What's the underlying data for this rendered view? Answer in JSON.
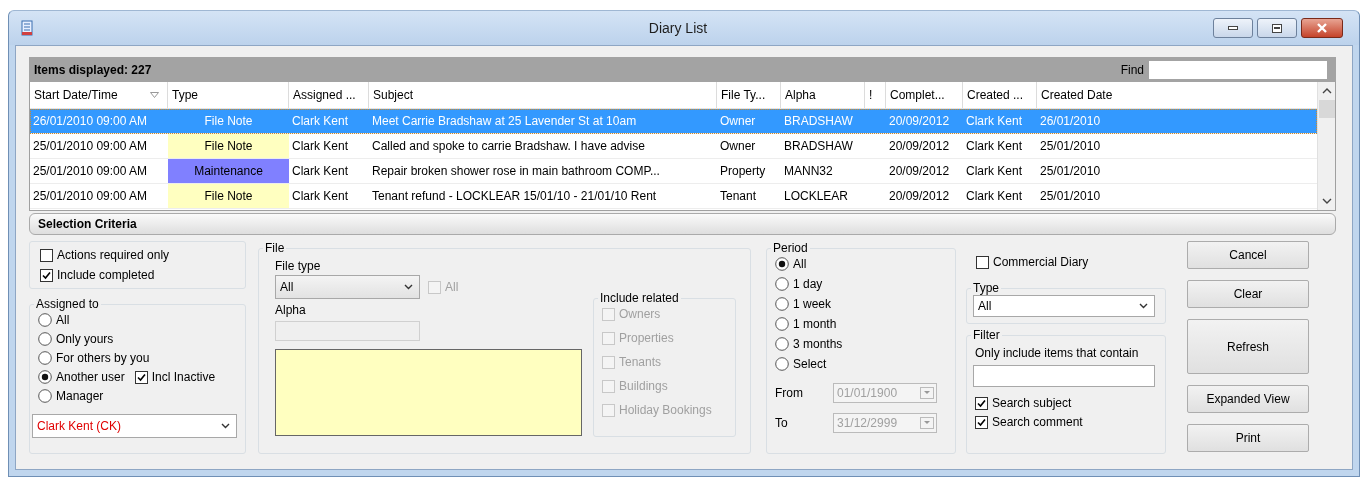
{
  "window": {
    "title": "Diary List"
  },
  "list": {
    "items_displayed": "Items displayed: 227",
    "find_label": "Find",
    "columns": [
      {
        "label": "Start Date/Time",
        "sorted": true
      },
      {
        "label": "Type",
        "sorted": false
      },
      {
        "label": "Assigned ...",
        "sorted": false
      },
      {
        "label": "Subject",
        "sorted": false
      },
      {
        "label": "File Ty...",
        "sorted": false
      },
      {
        "label": "Alpha",
        "sorted": false
      },
      {
        "label": "!",
        "sorted": false
      },
      {
        "label": "Complet...",
        "sorted": false
      },
      {
        "label": "Created ...",
        "sorted": false
      },
      {
        "label": "Created Date",
        "sorted": false
      }
    ],
    "rows": [
      {
        "selected": true,
        "cells": [
          "26/01/2010 09:00 AM",
          "File Note",
          "Clark Kent",
          "Meet Carrie Bradshaw at 25 Lavender St at 10am",
          "Owner",
          "BRADSHAW",
          "",
          "20/09/2012",
          "Clark Kent",
          "26/01/2010"
        ]
      },
      {
        "selected": false,
        "color": "#ffffc0",
        "cells": [
          "25/01/2010 09:00 AM",
          "File Note",
          "Clark Kent",
          "Called and spoke to carrie Bradshaw. I have advise",
          "Owner",
          "BRADSHAW",
          "",
          "20/09/2012",
          "Clark Kent",
          "25/01/2010"
        ]
      },
      {
        "selected": false,
        "color": "#8080ff",
        "cells": [
          "25/01/2010 09:00 AM",
          "Maintenance",
          "Clark Kent",
          "Repair broken shower rose in main bathroom COMP...",
          "Property",
          "MANN32",
          "",
          "20/09/2012",
          "Clark Kent",
          "25/01/2010"
        ]
      },
      {
        "selected": false,
        "color": "#ffffc0",
        "cells": [
          "25/01/2010 09:00 AM",
          "File Note",
          "Clark Kent",
          "Tenant refund - LOCKLEAR 15/01/10 - 21/01/10 Rent",
          "Tenant",
          "LOCKLEAR",
          "",
          "20/09/2012",
          "Clark Kent",
          "25/01/2010"
        ]
      }
    ]
  },
  "selection_criteria": {
    "title": "Selection Criteria",
    "options": [
      {
        "label": "Actions required only",
        "checked": false
      },
      {
        "label": "Include completed",
        "checked": true
      }
    ],
    "assigned_to": {
      "title": "Assigned to",
      "options": [
        {
          "label": "All",
          "selected": false
        },
        {
          "label": "Only yours",
          "selected": false
        },
        {
          "label": "For others by you",
          "selected": false
        },
        {
          "label": "Another user",
          "selected": true,
          "checkbox": {
            "label": "Incl Inactive",
            "checked": true
          }
        },
        {
          "label": "Manager",
          "selected": false
        }
      ],
      "user": "Clark Kent (CK)"
    }
  },
  "file": {
    "title": "File",
    "file_type_label": "File type",
    "file_type": "All",
    "all_checkbox": {
      "label": "All",
      "checked": false,
      "disabled": true
    },
    "alpha_label": "Alpha",
    "include_related": {
      "title": "Include related",
      "items": [
        {
          "label": "Owners",
          "checked": false,
          "disabled": true
        },
        {
          "label": "Properties",
          "checked": false,
          "disabled": true
        },
        {
          "label": "Tenants",
          "checked": false,
          "disabled": true
        },
        {
          "label": "Buildings",
          "checked": false,
          "disabled": true
        },
        {
          "label": "Holiday Bookings",
          "checked": false,
          "disabled": true
        }
      ]
    }
  },
  "period": {
    "title": "Period",
    "options": [
      {
        "label": "All",
        "selected": true
      },
      {
        "label": "1 day",
        "selected": false
      },
      {
        "label": "1 week",
        "selected": false
      },
      {
        "label": "1 month",
        "selected": false
      },
      {
        "label": "3 months",
        "selected": false
      },
      {
        "label": "Select",
        "selected": false
      }
    ],
    "from": {
      "label": "From",
      "value": "01/01/1900",
      "disabled": true
    },
    "to": {
      "label": "To",
      "value": "31/12/2999",
      "disabled": true
    }
  },
  "commercial_diary": {
    "label": "Commercial Diary",
    "checked": false
  },
  "type": {
    "title": "Type",
    "value": "All"
  },
  "filter": {
    "title": "Filter",
    "hint": "Only include items that contain",
    "checks": [
      {
        "label": "Search subject",
        "checked": true
      },
      {
        "label": "Search comment",
        "checked": true
      }
    ]
  },
  "buttons": [
    {
      "label": "Cancel",
      "kind": "normal"
    },
    {
      "label": "Clear",
      "kind": "normal"
    },
    {
      "label": "Refresh",
      "kind": "large"
    },
    {
      "label": "Expanded View",
      "kind": "normal"
    },
    {
      "label": "Print",
      "kind": "normal"
    }
  ]
}
